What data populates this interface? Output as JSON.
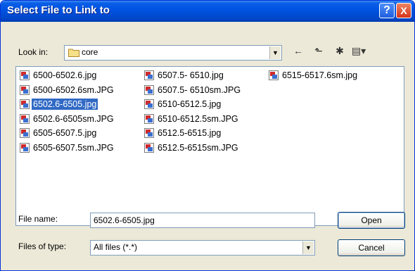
{
  "title": "Select File to Link to",
  "title_buttons": {
    "help": "?",
    "close": "X"
  },
  "look_in": {
    "label": "Look in:",
    "value": "core"
  },
  "toolbar": [
    {
      "name": "back-icon",
      "glyph": "←"
    },
    {
      "name": "up-folder-icon",
      "glyph": "⬑"
    },
    {
      "name": "new-folder-icon",
      "glyph": "✱"
    },
    {
      "name": "view-menu-icon",
      "glyph": "▤▾"
    }
  ],
  "files": [
    {
      "label": "6500-6502.6.jpg",
      "selected": false
    },
    {
      "label": "6500-6502.6sm.JPG",
      "selected": false
    },
    {
      "label": "6502.6-6505.jpg",
      "selected": true
    },
    {
      "label": "6502.6-6505sm.JPG",
      "selected": false
    },
    {
      "label": "6505-6507.5.jpg",
      "selected": false
    },
    {
      "label": "6505-6507.5sm.JPG",
      "selected": false
    },
    {
      "label": "6507.5- 6510.jpg",
      "selected": false
    },
    {
      "label": "6507.5- 6510sm.JPG",
      "selected": false
    },
    {
      "label": "6510-6512.5.jpg",
      "selected": false
    },
    {
      "label": "6510-6512.5sm.JPG",
      "selected": false
    },
    {
      "label": "6512.5-6515.jpg",
      "selected": false
    },
    {
      "label": "6512.5-6515sm.JPG",
      "selected": false
    },
    {
      "label": "6515-6517.6sm.jpg",
      "selected": false
    }
  ],
  "file_name": {
    "label": "File name:",
    "value": "6502.6-6505.jpg"
  },
  "file_type": {
    "label": "Files of type:",
    "value": "All files (*.*)"
  },
  "buttons": {
    "open": "Open",
    "cancel": "Cancel"
  },
  "colors": {
    "title_bar": "#0054e3",
    "selection": "#316ac5",
    "face": "#ece9d8"
  }
}
